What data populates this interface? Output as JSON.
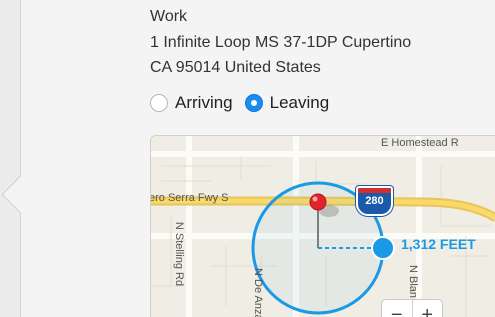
{
  "location": {
    "name": "Work",
    "address_line1": "1 Infinite Loop MS 37-1DP Cupertino",
    "address_line2": "CA 95014 United States"
  },
  "trigger": {
    "options": [
      {
        "label": "Arriving",
        "selected": false
      },
      {
        "label": "Leaving",
        "selected": true
      }
    ]
  },
  "map": {
    "streets": {
      "homestead": "E Homestead R",
      "serra": "ero Serra Fwy S",
      "stelling": "N Stelling Rd",
      "de_anza": "N De Anza",
      "blaney": "N Blan"
    },
    "highway_shield": "280",
    "radius_label": "1,312 FEET",
    "zoom_out": "−",
    "zoom_in": "+",
    "accent_color": "#1a9ae6",
    "pin_color": "#e0242b"
  }
}
